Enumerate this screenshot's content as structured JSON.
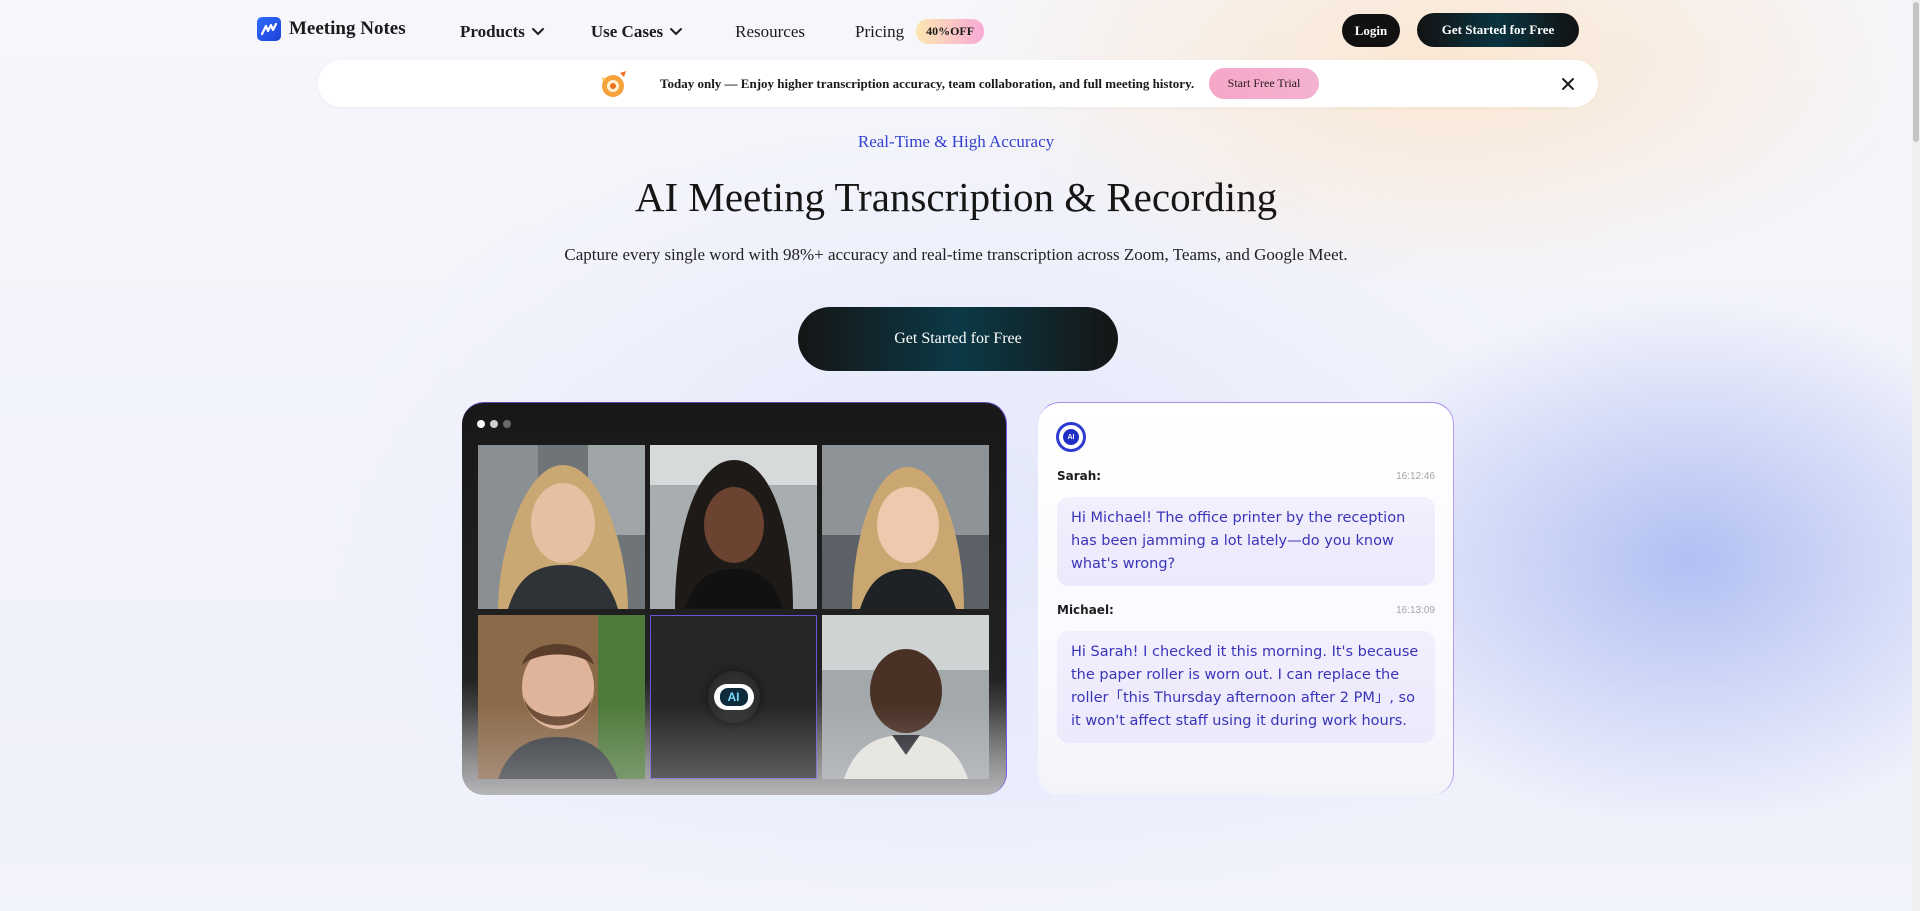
{
  "nav": {
    "logo_text": "Meeting Notes",
    "products": "Products",
    "use_cases": "Use Cases",
    "resources": "Resources",
    "pricing": "Pricing",
    "pricing_badge": "40%OFF",
    "login": "Login",
    "cta": "Get Started for Free"
  },
  "announcement": {
    "text": "Today only — Enjoy higher transcription accuracy, team collaboration, and full meeting history.",
    "button": "Start Free Trial"
  },
  "hero": {
    "eyebrow": "Real-Time & High Accuracy",
    "title": "AI Meeting Transcription & Recording",
    "subtitle": "Capture every single word with 98%+ accuracy and real-time transcription across Zoom, Teams, and Google Meet.",
    "cta": "Get Started for Free"
  },
  "video": {
    "ai_label": "AI"
  },
  "chat": {
    "avatar_label": "AI",
    "messages": [
      {
        "speaker": "Sarah:",
        "time": "16:12:46",
        "text": "Hi Michael! The office printer by the reception has been jamming a lot lately—do you know what's wrong?"
      },
      {
        "speaker": "Michael:",
        "time": "16:13:09",
        "text": "Hi Sarah! I checked it this morning. It's because the paper roller is worn out. I can replace the roller「this Thursday afternoon after 2 PM」, so it won't affect staff using it during work hours."
      }
    ]
  },
  "colors": {
    "accent": "#3440cf",
    "bubble_text": "#3a35b8",
    "promo_gradient_start": "#fce7b0",
    "promo_gradient_end": "#f7a9d6"
  }
}
